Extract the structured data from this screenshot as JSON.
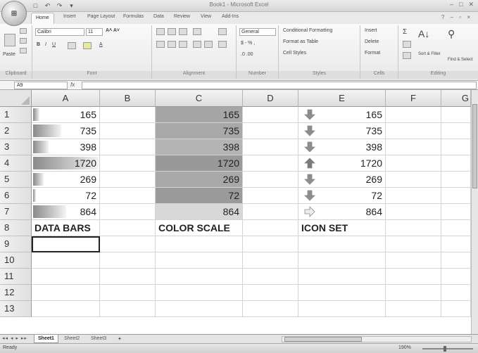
{
  "window": {
    "title": "Book1 - Microsoft Excel",
    "office_button": "⊞",
    "qat_items": [
      "save-icon",
      "undo-icon",
      "redo-icon",
      "customize-icon"
    ],
    "controls": [
      "minimize-icon",
      "maximize-icon",
      "close-icon"
    ]
  },
  "ribbon": {
    "tabs": [
      "Home",
      "Insert",
      "Page Layout",
      "Formulas",
      "Data",
      "Review",
      "View",
      "Add-Ins"
    ],
    "active_tab": "Home",
    "clipboard": {
      "paste": "Paste",
      "label": "Clipboard"
    },
    "font": {
      "name": "Calibri",
      "size": "11",
      "label": "Font"
    },
    "alignment": {
      "label": "Alignment"
    },
    "number": {
      "format": "General",
      "label": "Number",
      "currency": "$ - % ,",
      "decimals": ".0 .00"
    },
    "styles": {
      "conditional": "Conditional Formatting",
      "format_table": "Format as Table",
      "cell_styles": "Cell Styles",
      "label": "Styles"
    },
    "cells": {
      "insert": "Insert",
      "delete": "Delete",
      "format": "Format",
      "label": "Cells"
    },
    "editing": {
      "sum": "Σ",
      "sort": "Sort & Filter",
      "find": "Find & Select",
      "label": "Editing"
    }
  },
  "formula_bar": {
    "name_box": "A9",
    "fx": "fx",
    "content": ""
  },
  "grid": {
    "columns": [
      "A",
      "B",
      "C",
      "D",
      "E",
      "F",
      "G"
    ],
    "rows": [
      "1",
      "2",
      "3",
      "4",
      "5",
      "6",
      "7",
      "8",
      "9",
      "10",
      "11",
      "12",
      "13"
    ],
    "values": [
      165,
      735,
      398,
      1720,
      269,
      72,
      864
    ],
    "color_scale_shades": [
      "#a6a6a6",
      "#a8a8a8",
      "#b4b4b4",
      "#999999",
      "#a8a8a8",
      "#9a9a9a",
      "#d8d8d8"
    ],
    "icon_directions": [
      "down",
      "down",
      "down",
      "up",
      "down",
      "down",
      "right"
    ],
    "labels": {
      "data_bars": "DATA BARS",
      "color_scale": "COLOR SCALE",
      "icon_set": "ICON SET"
    },
    "selected_cell": "A9"
  },
  "sheets": {
    "tabs": [
      "Sheet1",
      "Sheet2",
      "Sheet3"
    ],
    "active": "Sheet1"
  },
  "status": {
    "text": "Ready",
    "zoom": "190%"
  }
}
